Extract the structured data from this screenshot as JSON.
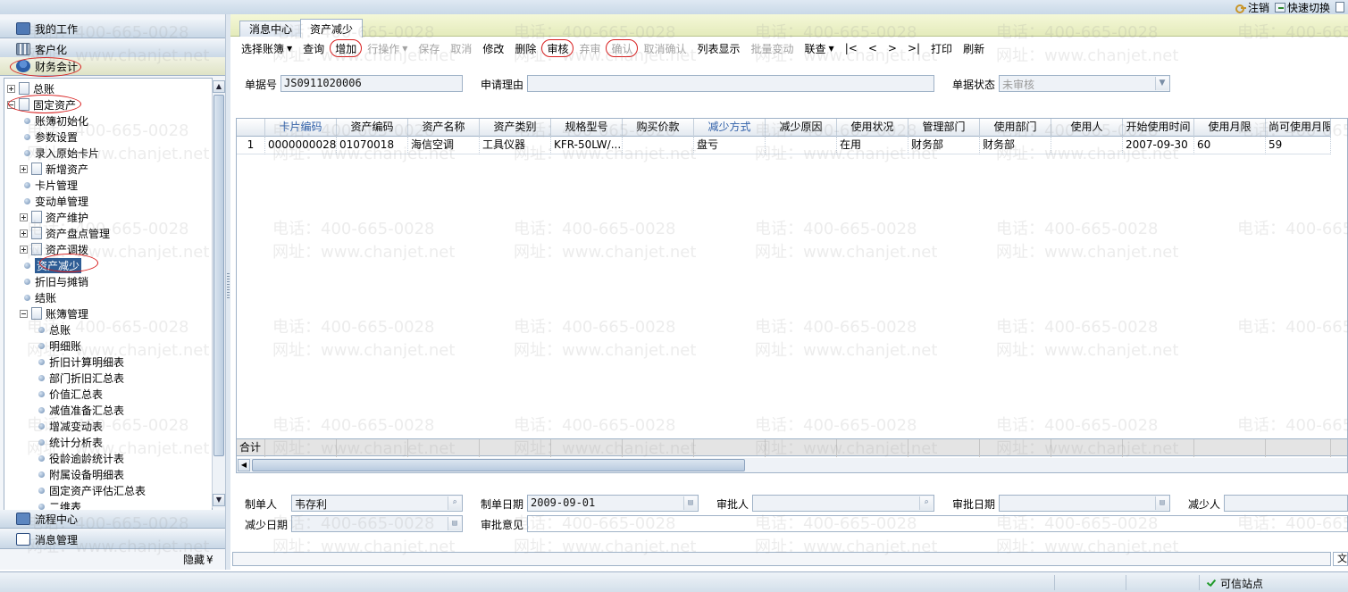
{
  "topbar": {
    "logout": "注销",
    "quick_switch": "快速切换"
  },
  "nav": {
    "my_work": "我的工作",
    "customize": "客户化",
    "finance": "财务会计",
    "workflow": "流程中心",
    "messages": "消息管理",
    "hide": "隐藏",
    "hide_glyph": "¥"
  },
  "tree": [
    {
      "label": "总账",
      "level": 0,
      "kind": "folder",
      "exp": "plus"
    },
    {
      "label": "固定资产",
      "level": 0,
      "kind": "folder",
      "exp": "minus"
    },
    {
      "label": "账簿初始化",
      "level": 1,
      "kind": "leaf"
    },
    {
      "label": "参数设置",
      "level": 1,
      "kind": "leaf"
    },
    {
      "label": "录入原始卡片",
      "level": 1,
      "kind": "leaf"
    },
    {
      "label": "新增资产",
      "level": 1,
      "kind": "folder",
      "exp": "plus"
    },
    {
      "label": "卡片管理",
      "level": 1,
      "kind": "leaf"
    },
    {
      "label": "变动单管理",
      "level": 1,
      "kind": "leaf"
    },
    {
      "label": "资产维护",
      "level": 1,
      "kind": "folder",
      "exp": "plus"
    },
    {
      "label": "资产盘点管理",
      "level": 1,
      "kind": "folder",
      "exp": "plus"
    },
    {
      "label": "资产调拨",
      "level": 1,
      "kind": "folder",
      "exp": "plus"
    },
    {
      "label": "资产减少",
      "level": 1,
      "kind": "leaf",
      "selected": true
    },
    {
      "label": "折旧与摊销",
      "level": 1,
      "kind": "leaf"
    },
    {
      "label": "结账",
      "level": 1,
      "kind": "leaf"
    },
    {
      "label": "账簿管理",
      "level": 1,
      "kind": "folder",
      "exp": "minus"
    },
    {
      "label": "总账",
      "level": 2,
      "kind": "leaf"
    },
    {
      "label": "明细账",
      "level": 2,
      "kind": "leaf"
    },
    {
      "label": "折旧计算明细表",
      "level": 2,
      "kind": "leaf"
    },
    {
      "label": "部门折旧汇总表",
      "level": 2,
      "kind": "leaf"
    },
    {
      "label": "价值汇总表",
      "level": 2,
      "kind": "leaf"
    },
    {
      "label": "减值准备汇总表",
      "level": 2,
      "kind": "leaf"
    },
    {
      "label": "增减变动表",
      "level": 2,
      "kind": "leaf"
    },
    {
      "label": "统计分析表",
      "level": 2,
      "kind": "leaf"
    },
    {
      "label": "役龄逾龄统计表",
      "level": 2,
      "kind": "leaf"
    },
    {
      "label": "附属设备明细表",
      "level": 2,
      "kind": "leaf"
    },
    {
      "label": "固定资产评估汇总表",
      "level": 2,
      "kind": "leaf"
    },
    {
      "label": "二维表",
      "level": 2,
      "kind": "leaf"
    }
  ],
  "tabs": [
    {
      "label": "消息中心",
      "active": false
    },
    {
      "label": "资产减少",
      "active": true
    }
  ],
  "toolbar": [
    {
      "label": "选择账簿",
      "caret": true,
      "enabled": true
    },
    {
      "label": "查询",
      "enabled": true
    },
    {
      "label": "增加",
      "enabled": true,
      "circled": true
    },
    {
      "label": "行操作",
      "caret": true,
      "enabled": false
    },
    {
      "label": "保存",
      "enabled": false
    },
    {
      "label": "取消",
      "enabled": false
    },
    {
      "label": "修改",
      "enabled": true
    },
    {
      "label": "删除",
      "enabled": true
    },
    {
      "label": "审核",
      "enabled": true,
      "circled": true
    },
    {
      "label": "弃审",
      "enabled": false
    },
    {
      "label": "确认",
      "enabled": false,
      "circled": true
    },
    {
      "label": "取消确认",
      "enabled": false
    },
    {
      "label": "列表显示",
      "enabled": true
    },
    {
      "label": "批量变动",
      "enabled": false
    },
    {
      "label": "联查",
      "caret": true,
      "enabled": true
    },
    {
      "label": "|<",
      "enabled": true
    },
    {
      "label": "<",
      "enabled": true
    },
    {
      "label": ">",
      "enabled": true
    },
    {
      "label": ">|",
      "enabled": true
    },
    {
      "label": "打印",
      "enabled": true
    },
    {
      "label": "刷新",
      "enabled": true
    }
  ],
  "form": {
    "doc_no_label": "单据号",
    "doc_no": "JS0911020006",
    "reason_label": "申请理由",
    "reason": "",
    "status_label": "单据状态",
    "status": "未审核",
    "maker_label": "制单人",
    "maker": "韦存利",
    "make_date_label": "制单日期",
    "make_date": "2009-09-01",
    "approver_label": "审批人",
    "approver": "",
    "approve_date_label": "审批日期",
    "approve_date": "",
    "reducer_label": "减少人",
    "reducer": "",
    "reduce_date_label": "减少日期",
    "reduce_date": "",
    "approve_opinion_label": "审批意见",
    "approve_opinion": ""
  },
  "grid": {
    "columns": [
      "",
      "卡片编码",
      "资产编码",
      "资产名称",
      "资产类别",
      "规格型号",
      "购买价款",
      "减少方式",
      "减少原因",
      "使用状况",
      "管理部门",
      "使用部门",
      "使用人",
      "开始使用时间",
      "使用月限",
      "尚可使用月限"
    ],
    "highlight_columns": [
      1,
      7
    ],
    "rows": [
      [
        "1",
        "0000000028",
        "01070018",
        "海信空调",
        "工具仪器",
        "KFR-50LW/...",
        "",
        "盘亏",
        "",
        "在用",
        "财务部",
        "财务部",
        "",
        "2007-09-30",
        "60",
        "59"
      ]
    ],
    "total_label": "合计"
  },
  "bottom_right_char": "文",
  "statusbar": {
    "trusted": "可信站点"
  },
  "watermark": {
    "phone": "电话：400-665-0028",
    "site": "网址：www.chanjet.net"
  },
  "colors": {
    "annotation_red": "#d81e1e",
    "selected_bg": "#2e5d95",
    "header_blue": "#2f5fa8"
  }
}
